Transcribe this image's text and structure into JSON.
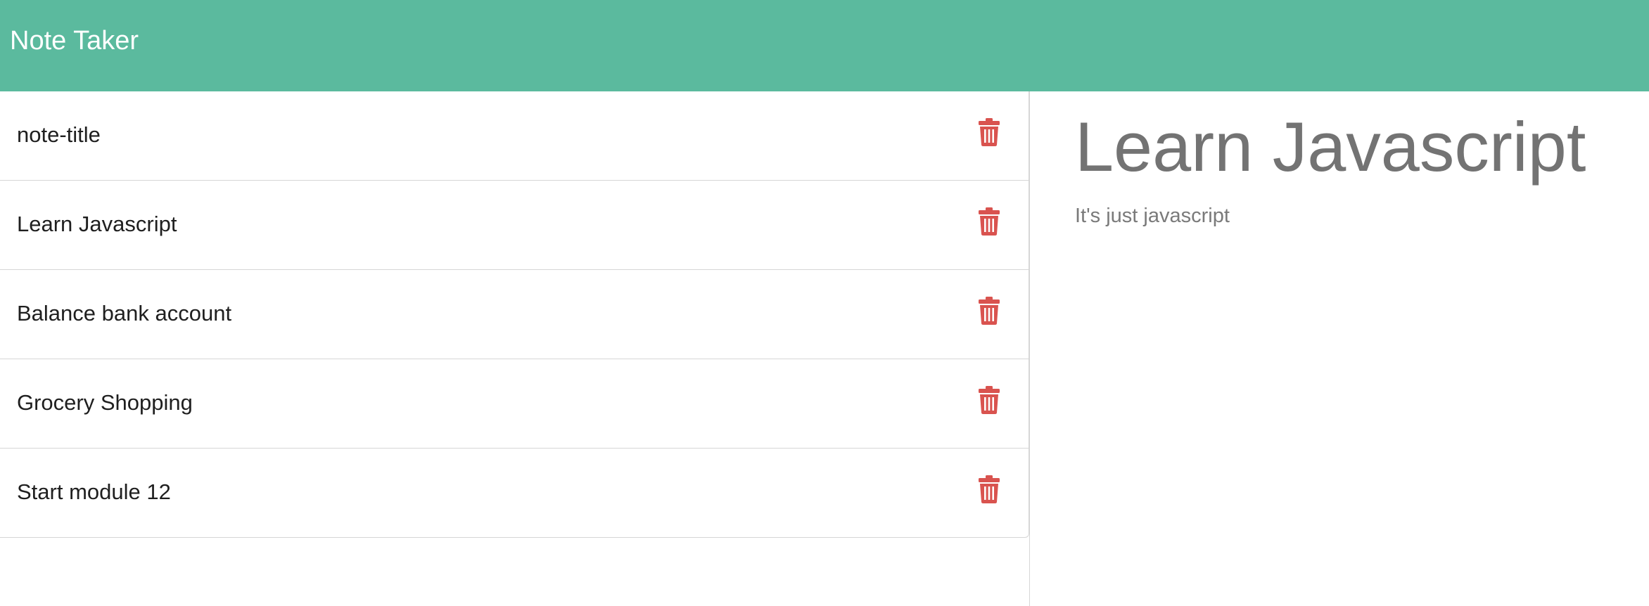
{
  "app": {
    "brand": "Note Taker",
    "accent_color": "#5bba9e",
    "delete_color": "#d9534f"
  },
  "notes": [
    {
      "title": "note-title",
      "icon": "trash-icon"
    },
    {
      "title": "Learn Javascript",
      "icon": "trash-icon"
    },
    {
      "title": "Balance bank account",
      "icon": "trash-icon"
    },
    {
      "title": "Grocery Shopping",
      "icon": "trash-icon"
    },
    {
      "title": "Start module 12",
      "icon": "trash-icon"
    }
  ],
  "active_note": {
    "title": "Learn Javascript",
    "text": "It's just javascript"
  }
}
